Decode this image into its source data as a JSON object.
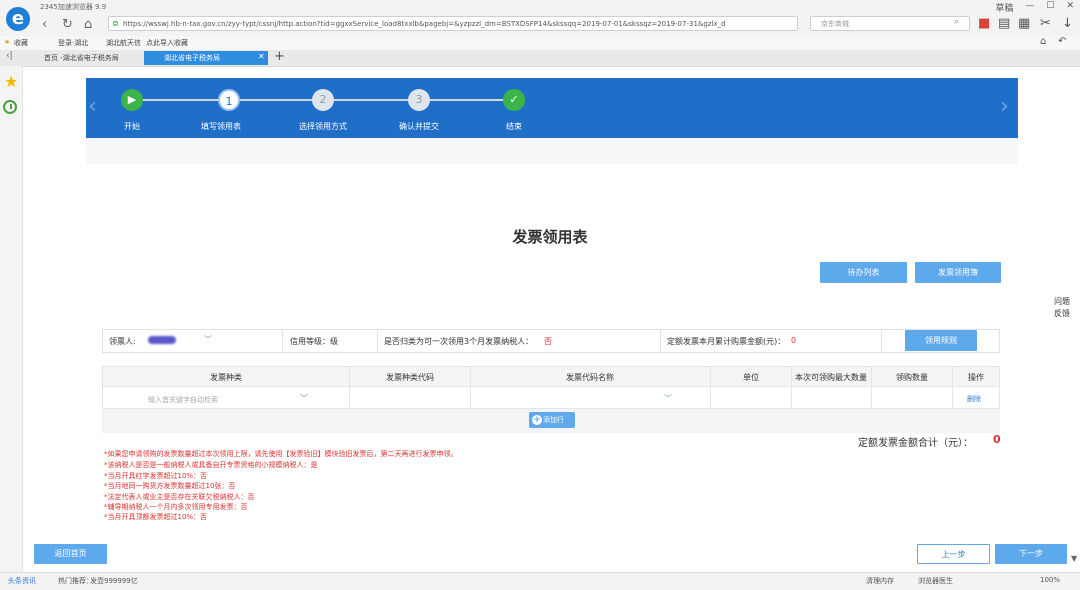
{
  "browser": {
    "name": "2345加速浏览器 9.9",
    "url": "https://wsswj.hb-n-tax.gov.cn/zyy-typt/cssnj/http.action?tid=ggxxService_load8txxlb&pagebj=&yzpzzl_dm=BSTXDSFP14&skssqq=2019-07-01&skssqz=2019-07-31&gzlx_d",
    "search_placeholder": "京东商城",
    "bookmarks": [
      "收藏",
      "登录·湖北",
      "湖北航天信",
      "点此导入收藏"
    ],
    "tabs": [
      "首页 -湖北省电子税务局",
      "湖北省电子税务局"
    ],
    "win_controls": [
      "草稿",
      "—",
      "☐",
      "✕"
    ]
  },
  "steps": [
    {
      "label": "开始",
      "state": "done",
      "mark": "▶"
    },
    {
      "label": "填写领用表",
      "state": "current",
      "mark": "1"
    },
    {
      "label": "选择领用方式",
      "state": "todo",
      "mark": "2"
    },
    {
      "label": "确认并提交",
      "state": "todo",
      "mark": "3"
    },
    {
      "label": "结束",
      "state": "done",
      "mark": "✓"
    }
  ],
  "page": {
    "title": "发票领用表",
    "btn_list": "待办列表",
    "btn_book": "发票领用簿"
  },
  "info": {
    "recipient_label": "领票人:",
    "credit_label": "信用等级：级",
    "three_month_label": "是否归类为可一次领用3个月发票纳税人：",
    "three_month_value": "否",
    "quota_label": "定额发票本月累计购票金额(元)：",
    "quota_value": "0",
    "btn_rules": "领用规则"
  },
  "table": {
    "headers": [
      "发票种类",
      "发票种类代码",
      "发票代码名称",
      "单位",
      "本次可领购最大数量",
      "领购数量",
      "操作"
    ],
    "placeholder": "输入首关键字自动检索",
    "delete": "删除",
    "add_row": "添加行"
  },
  "total": {
    "label": "定额发票金额合计（元）：",
    "value": "0"
  },
  "notes": [
    "*如果您申请领购的发票数量超过本次领用上限，请先使用【发票验旧】模块验旧发票后，第二天再进行发票申领。",
    "*该纳税人是否是一般纳税人或具备自开专票资格的小规模纳税人：是",
    "*当月开具红字发票超过10%：否",
    "*当月地同一购货方发票数量超过10张：否",
    "*法定代表人或业主是否存在关联欠税纳税人：否",
    "*辅导期纳税人一个月内多次领用专用发票：否",
    "*当月开具顶额发票超过10%：否"
  ],
  "feedback": "问题反馈",
  "footer": {
    "btn_home": "返回首页",
    "btn_prev": "上一步",
    "btn_next": "下一步"
  },
  "status": {
    "news": "头条资讯",
    "hot": "热门推荐：",
    "hot_value": "发壶999999亿",
    "memory": "清理内存",
    "doctor": "浏览器医生",
    "zoom": "100%"
  },
  "colors": {
    "banner": "#1f6fc8",
    "button": "#5ea8ec",
    "accent_red": "#e03030"
  }
}
